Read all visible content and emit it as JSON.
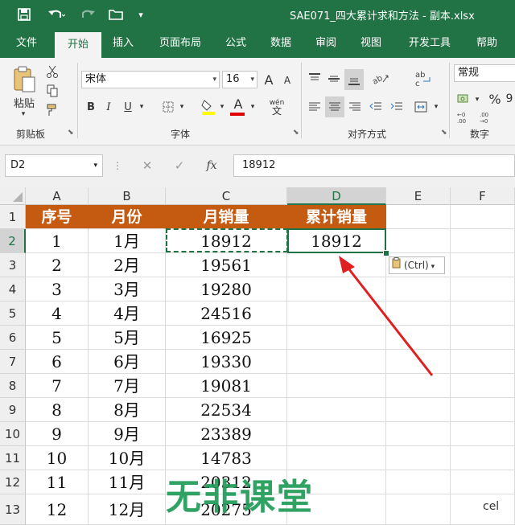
{
  "titlebar": {
    "file_name": "SAE071_四大累计求和方法 - 副本.xlsx",
    "save_icon": "save-icon",
    "undo_icon": "undo-icon",
    "redo_icon": "redo-icon",
    "open_icon": "folder-icon",
    "customize_icon": "customize-icon"
  },
  "tabs": [
    {
      "label": "文件"
    },
    {
      "label": "开始"
    },
    {
      "label": "插入"
    },
    {
      "label": "页面布局"
    },
    {
      "label": "公式"
    },
    {
      "label": "数据"
    },
    {
      "label": "审阅"
    },
    {
      "label": "视图"
    },
    {
      "label": "开发工具"
    },
    {
      "label": "帮助"
    }
  ],
  "ribbon": {
    "clipboard": {
      "paste_label": "粘贴",
      "group_label": "剪贴板"
    },
    "font": {
      "font_name": "宋体",
      "font_size": "16",
      "bold": "B",
      "italic": "I",
      "underline": "U",
      "group_label": "字体",
      "grow": "A",
      "shrink": "A",
      "font_color": "A",
      "phonetic": "wén"
    },
    "alignment": {
      "group_label": "对齐方式"
    },
    "number": {
      "format": "常规",
      "percent": "%",
      "group_label": "数字",
      "comma": "9"
    }
  },
  "formula_bar": {
    "name_box": "D2",
    "cancel": "✕",
    "enter": "✓",
    "fx": "fx",
    "value": "18912"
  },
  "grid": {
    "columns": [
      "A",
      "B",
      "C",
      "D",
      "E",
      "F"
    ],
    "rows": [
      "1",
      "2",
      "3",
      "4",
      "5",
      "6",
      "7",
      "8",
      "9",
      "10",
      "11",
      "12",
      "13"
    ],
    "header_row": [
      "序号",
      "月份",
      "月销量",
      "累计销量"
    ],
    "data": [
      [
        "1",
        "1月",
        "18912",
        "18912"
      ],
      [
        "2",
        "2月",
        "19561",
        ""
      ],
      [
        "3",
        "3月",
        "19280",
        ""
      ],
      [
        "4",
        "4月",
        "24516",
        ""
      ],
      [
        "5",
        "5月",
        "16925",
        ""
      ],
      [
        "6",
        "6月",
        "19330",
        ""
      ],
      [
        "7",
        "7月",
        "19081",
        ""
      ],
      [
        "8",
        "8月",
        "22534",
        ""
      ],
      [
        "9",
        "9月",
        "23389",
        ""
      ],
      [
        "10",
        "10月",
        "14783",
        ""
      ],
      [
        "11",
        "11月",
        "20312",
        ""
      ],
      [
        "12",
        "12月",
        "20275",
        ""
      ]
    ],
    "paste_options": "(Ctrl)"
  },
  "watermark": {
    "text": "无非课堂",
    "corner": "cel"
  },
  "colors": {
    "accent": "#217346",
    "header_fill": "#c55a11",
    "arrow": "#e02020"
  }
}
